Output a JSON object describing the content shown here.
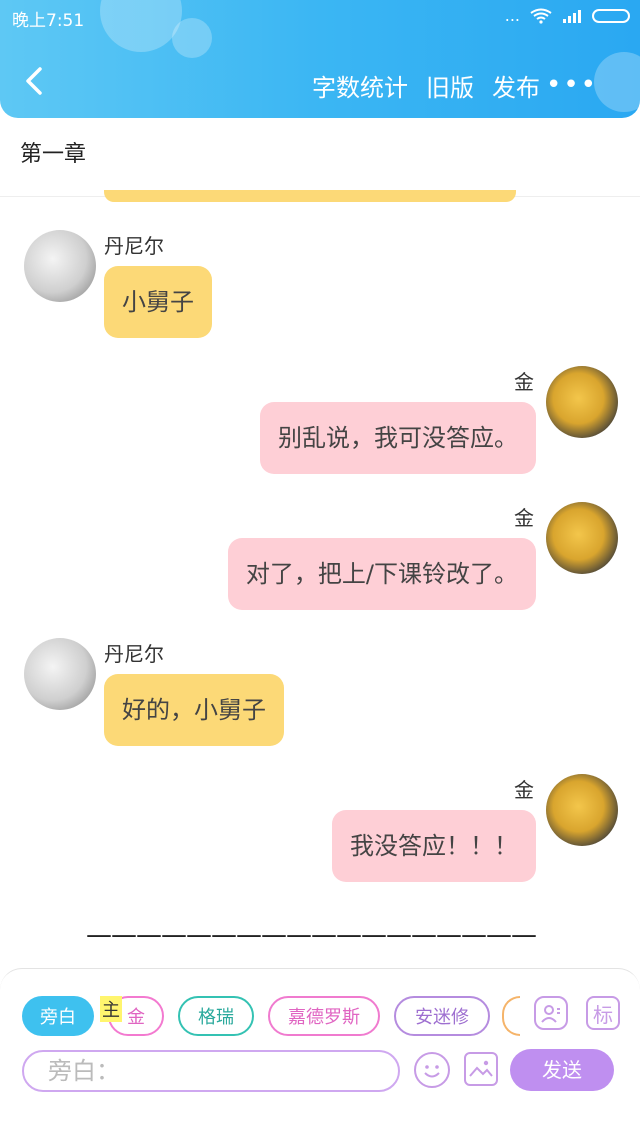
{
  "status_bar": {
    "time": "晚上7:51",
    "signal": "...",
    "wifi_icon": "wifi-icon",
    "battery_icon": "battery-icon"
  },
  "header": {
    "back_icon": "chevron-left-icon",
    "word_count": "字数统计",
    "old_version": "旧版",
    "publish": "发布",
    "more": "•••"
  },
  "chapter_title": "第一章",
  "messages": [
    {
      "name": "丹尼尔",
      "text": "小舅子"
    },
    {
      "name": "金",
      "text": "别乱说，我可没答应。"
    },
    {
      "name": "金",
      "text": "对了，把上/下课铃改了。"
    },
    {
      "name": "丹尼尔",
      "text": "好的，小舅子"
    },
    {
      "name": "金",
      "text": "我没答应！！！"
    }
  ],
  "divider_text": "——————————————————",
  "roles": {
    "narrator": "旁白",
    "main_badge": "主",
    "items": [
      "金",
      "格瑞",
      "嘉德罗斯",
      "安迷修"
    ],
    "tag_button": "标"
  },
  "input": {
    "placeholder": "旁白："
  },
  "send_label": "发送",
  "colors": {
    "header": "#3bb6f3",
    "yellow_bubble": "#fcd977",
    "pink_bubble": "#fecfd6",
    "send": "#bf8ff0"
  }
}
